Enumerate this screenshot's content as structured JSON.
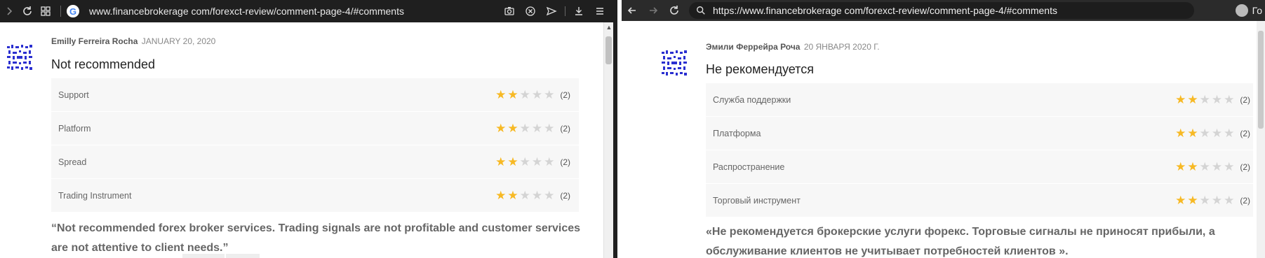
{
  "left": {
    "url": "www.financebrokerage com/forexct-review/comment-page-4/#comments",
    "comment": {
      "author": "Emilly Ferreira Rocha",
      "date": "JANUARY 20, 2020",
      "title": "Not recommended",
      "ratings": [
        {
          "label": "Support",
          "stars": 2,
          "count": "(2)"
        },
        {
          "label": "Platform",
          "stars": 2,
          "count": "(2)"
        },
        {
          "label": "Spread",
          "stars": 2,
          "count": "(2)"
        },
        {
          "label": "Trading Instrument",
          "stars": 2,
          "count": "(2)"
        }
      ],
      "quote": "“Not recommended forex broker services. Trading signals are not profitable and customer services are not attentive to client needs.”"
    }
  },
  "right": {
    "url": "https://www.financebrokerage com/forexct-review/comment-page-4/#comments",
    "profile_text": "Го",
    "comment": {
      "author": "Эмили Феррейра Роча",
      "date": "20 ЯНВАРЯ 2020 Г.",
      "title": "Не рекомендуется",
      "ratings": [
        {
          "label": "Служба поддержки",
          "stars": 2,
          "count": "(2)"
        },
        {
          "label": "Платформа",
          "stars": 2,
          "count": "(2)"
        },
        {
          "label": "Распространение",
          "stars": 2,
          "count": "(2)"
        },
        {
          "label": "Торговый инструмент",
          "stars": 2,
          "count": "(2)"
        }
      ],
      "quote": "«Не рекомендуется брокерские услуги форекс. Торговые сигналы не приносят прибыли, а обслуживание клиентов не учитывает потребностей клиентов »."
    }
  },
  "colors": {
    "star_on": "#f7b924",
    "star_off": "#d4d4d4",
    "avatar": "#2a2fd0"
  }
}
